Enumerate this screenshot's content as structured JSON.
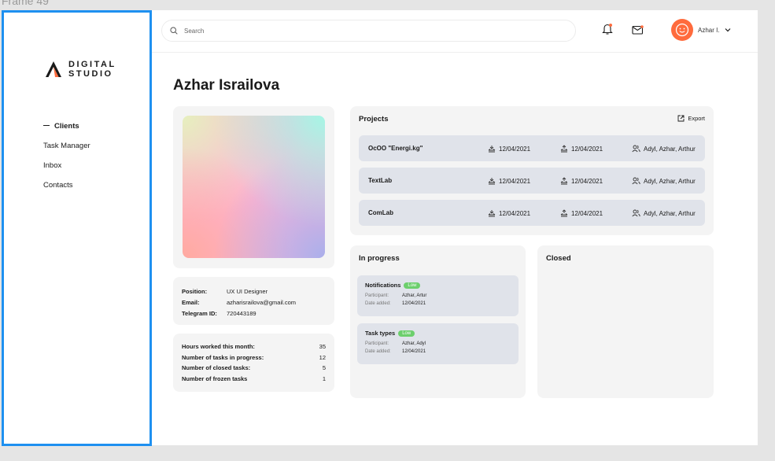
{
  "frame_label": "Frame 49",
  "brand": {
    "line1": "DIGITAL",
    "line2": "STUDIO"
  },
  "sidebar": {
    "items": [
      {
        "label": "Clients",
        "active": true
      },
      {
        "label": "Task Manager",
        "active": false
      },
      {
        "label": "Inbox",
        "active": false
      },
      {
        "label": "Contacts",
        "active": false
      }
    ]
  },
  "topbar": {
    "search_placeholder": "Search",
    "user_name": "Azhar I.",
    "icons": [
      "search-icon",
      "bell-icon",
      "mail-icon",
      "smile-icon",
      "chevron-down-icon"
    ]
  },
  "profile": {
    "name": "Azhar Israilova",
    "position_label": "Position:",
    "position": "UX UI Designer",
    "email_label": "Email:",
    "email": "azharisrailova@gmail.com",
    "telegram_label": "Telegram ID:",
    "telegram": "720443189"
  },
  "stats": [
    {
      "label": "Hours worked this month:",
      "value": "35"
    },
    {
      "label": "Number of tasks in progress:",
      "value": "12"
    },
    {
      "label": "Number of closed tasks:",
      "value": "5"
    },
    {
      "label": "Number of frozen tasks",
      "value": "1"
    }
  ],
  "projects": {
    "title": "Projects",
    "export_label": "Export",
    "rows": [
      {
        "name": "OcOO \"Energi.kg\"",
        "start": "12/04/2021",
        "end": "12/04/2021",
        "team": "Adyl, Azhar, Arthur"
      },
      {
        "name": "TextLab",
        "start": "12/04/2021",
        "end": "12/04/2021",
        "team": "Adyl, Azhar, Arthur"
      },
      {
        "name": "ComLab",
        "start": "12/04/2021",
        "end": "12/04/2021",
        "team": "Adyl, Azhar, Arthur"
      }
    ]
  },
  "in_progress": {
    "title": "In progress",
    "tasks": [
      {
        "title": "Notifications",
        "badge": "Low",
        "participant_label": "Participant:",
        "participant": "Azhar, Artur",
        "date_label": "Date added:",
        "date": "12/04/2021"
      },
      {
        "title": "Task types",
        "badge": "Low",
        "participant_label": "Participant:",
        "participant": "Azhar, Adyl",
        "date_label": "Date added:",
        "date": "12/04/2021"
      }
    ]
  },
  "closed": {
    "title": "Closed"
  },
  "colors": {
    "accent": "#1e90f0",
    "avatar": "#ff6b3d",
    "badge": "#6ccf6c",
    "row_bg": "#e0e3ea"
  }
}
